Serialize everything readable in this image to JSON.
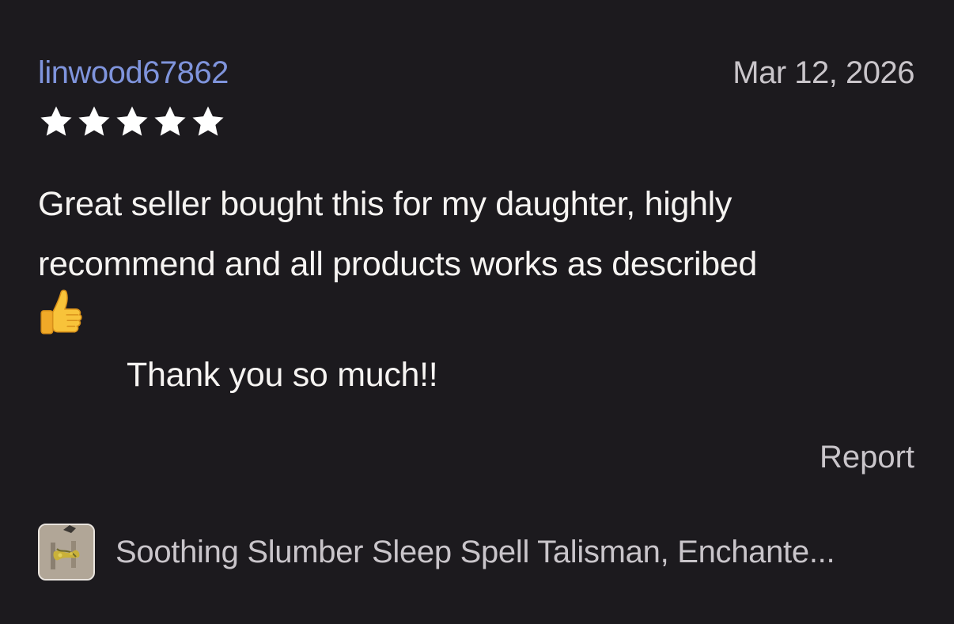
{
  "review": {
    "username": "linwood67862",
    "date": "Mar 12, 2026",
    "rating": 5,
    "rating_max": 5,
    "body": "Great seller bought this for my daughter, highly recommend and all products works as described",
    "emoji": "thumbs-up",
    "seller_reply": "Thank you so much!!",
    "report_label": "Report"
  },
  "product": {
    "title": "Soothing Slumber Sleep Spell Talisman, Enchante..."
  },
  "colors": {
    "background": "#1c1a1e",
    "username": "#7f94dc",
    "muted_text": "#c9c5ca",
    "body_text": "#f6f4f2",
    "star": "#ffffff",
    "emoji": "#f8c33a"
  }
}
